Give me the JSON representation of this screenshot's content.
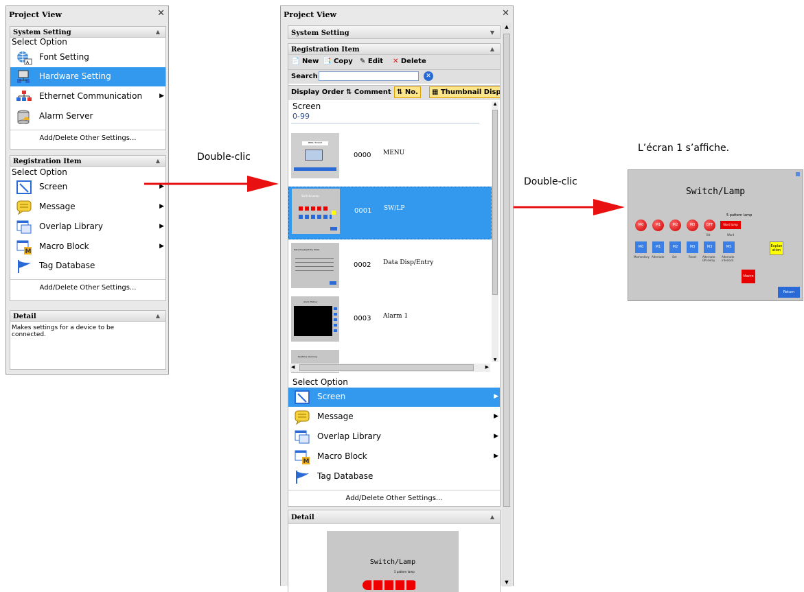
{
  "left_panel": {
    "title": "Project View",
    "system_setting": {
      "header": "System Setting",
      "select_option": "Select Option",
      "items": [
        {
          "label": "Font Setting",
          "icon": "globe-font-icon"
        },
        {
          "label": "Hardware Setting",
          "icon": "hardware-icon",
          "selected": true
        },
        {
          "label": "Ethernet Communication",
          "icon": "network-icon",
          "submenu": true
        },
        {
          "label": "Alarm Server",
          "icon": "alarm-server-icon"
        }
      ],
      "add_delete": "Add/Delete Other Settings..."
    },
    "registration": {
      "header": "Registration Item",
      "select_option": "Select Option",
      "items": [
        {
          "label": "Screen",
          "icon": "screen-icon",
          "submenu": true
        },
        {
          "label": "Message",
          "icon": "message-icon",
          "submenu": true
        },
        {
          "label": "Overlap Library",
          "icon": "overlap-library-icon",
          "submenu": true
        },
        {
          "label": "Macro Block",
          "icon": "macro-block-icon",
          "submenu": true
        },
        {
          "label": "Tag Database",
          "icon": "tag-flag-icon"
        }
      ],
      "add_delete": "Add/Delete Other Settings..."
    },
    "detail": {
      "header": "Detail",
      "text": "Makes settings for a device to be connected."
    }
  },
  "mid_panel": {
    "title": "Project View",
    "system_setting_header": "System Setting",
    "registration_header": "Registration Item",
    "toolbar": {
      "new": "New",
      "copy": "Copy",
      "edit": "Edit",
      "delete": "Delete"
    },
    "search_label": "Search",
    "search_value": "",
    "display_order": "Display Order",
    "comment": "Comment",
    "no": "No.",
    "thumbnail": "Thumbnail Disp",
    "list_header": "Screen",
    "group": "0-99",
    "screens": [
      {
        "num": "0000",
        "name": "MENU",
        "thumb_title": "MENU TOUCH"
      },
      {
        "num": "0001",
        "name": "SW/LP",
        "thumb_title": "Switch/Lamp",
        "selected": true
      },
      {
        "num": "0002",
        "name": "Data Disp/Entry",
        "thumb_title": "Data Display/Entry Mode"
      },
      {
        "num": "0003",
        "name": "Alarm 1",
        "thumb_title": "Alarm History"
      },
      {
        "num": "",
        "name": "",
        "thumb_title": "Realtime Alarming"
      }
    ],
    "select_option": "Select Option",
    "options": [
      {
        "label": "Screen",
        "icon": "screen-icon",
        "selected": true,
        "submenu": true
      },
      {
        "label": "Message",
        "icon": "message-icon",
        "submenu": true
      },
      {
        "label": "Overlap Library",
        "icon": "overlap-library-icon",
        "submenu": true
      },
      {
        "label": "Macro Block",
        "icon": "macro-block-icon",
        "submenu": true
      },
      {
        "label": "Tag Database",
        "icon": "tag-flag-icon"
      }
    ],
    "add_delete": "Add/Delete Other Settings...",
    "detail_header": "Detail",
    "preview_title": "Switch/Lamp",
    "preview_sub": "5 pattern lamp"
  },
  "annotations": {
    "double_click_1": "Double-clic",
    "double_click_2": "Double-clic",
    "result": "L’écran 1 s’affiche."
  },
  "screen_preview": {
    "title": "Switch/Lamp",
    "subtitle": "5 pattern lamp",
    "lamps": [
      "M0",
      "M1",
      "M2",
      "M3",
      "OFF"
    ],
    "lamp_captions": [
      "Bit",
      "Word"
    ],
    "lamp_word_label": "Word lamp",
    "switches": [
      "M0",
      "M1",
      "M2",
      "M3",
      "M3",
      "M5"
    ],
    "switch_captions": [
      "Momentary",
      "Alternate",
      "Set",
      "Reset",
      "Alternate ON delay",
      "Alternate interlock"
    ],
    "explanation": "Explanation",
    "macro": "Macro",
    "return": "Return",
    "colors": {
      "bg": "#c8c8c8",
      "lamp": "#e60000",
      "switch": "#3a7fe6",
      "explanation": "#ffff00"
    }
  }
}
